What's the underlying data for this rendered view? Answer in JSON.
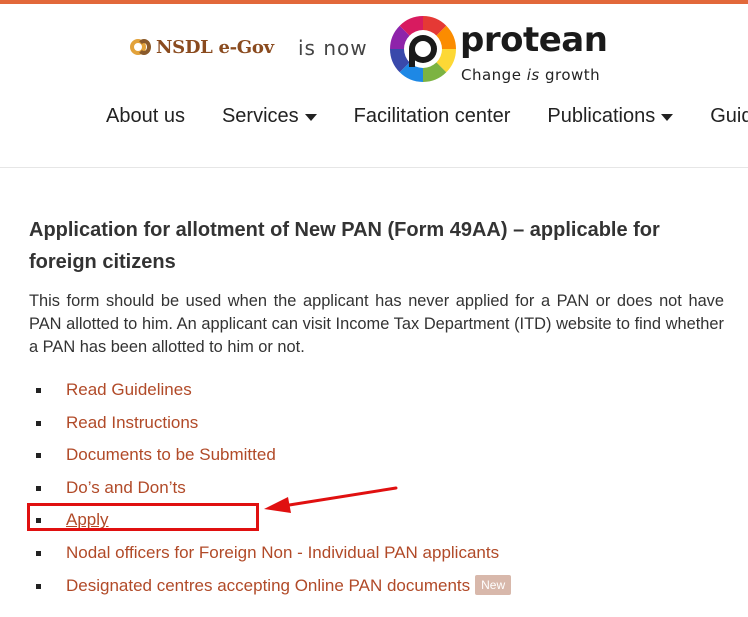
{
  "header": {
    "nsdl_logo_text": "NSDL e-Gov",
    "is_now_text": "is now",
    "protean_name": "protean",
    "tagline_before": "Change ",
    "tagline_italic": "is",
    "tagline_after": " growth"
  },
  "nav": {
    "items": [
      {
        "label": "About us",
        "dropdown": false
      },
      {
        "label": "Services",
        "dropdown": true
      },
      {
        "label": "Facilitation center",
        "dropdown": false
      },
      {
        "label": "Publications",
        "dropdown": true
      },
      {
        "label": "Guid",
        "dropdown": false
      }
    ]
  },
  "main": {
    "title": "Application for allotment of New PAN (Form 49AA) – applicable for foreign citizens",
    "intro": "This form should be used when the applicant has never applied for a PAN or does not have PAN allotted to him. An applicant can visit Income Tax Department (ITD) website to find whether a PAN has been allotted to him or not.",
    "links": [
      {
        "label": "Read Guidelines"
      },
      {
        "label": "Read Instructions"
      },
      {
        "label": "Documents to be Submitted"
      },
      {
        "label": "Do’s and Don’ts"
      },
      {
        "label": "Apply"
      },
      {
        "label": "Nodal officers for Foreign Non - Individual PAN applicants"
      },
      {
        "label": "Designated centres accepting Online PAN documents",
        "badge": "New"
      }
    ]
  },
  "colors": {
    "accent": "#e2683a",
    "link": "#b14a28",
    "annotation": "#e01010",
    "badge_bg": "#d8b8ab"
  }
}
